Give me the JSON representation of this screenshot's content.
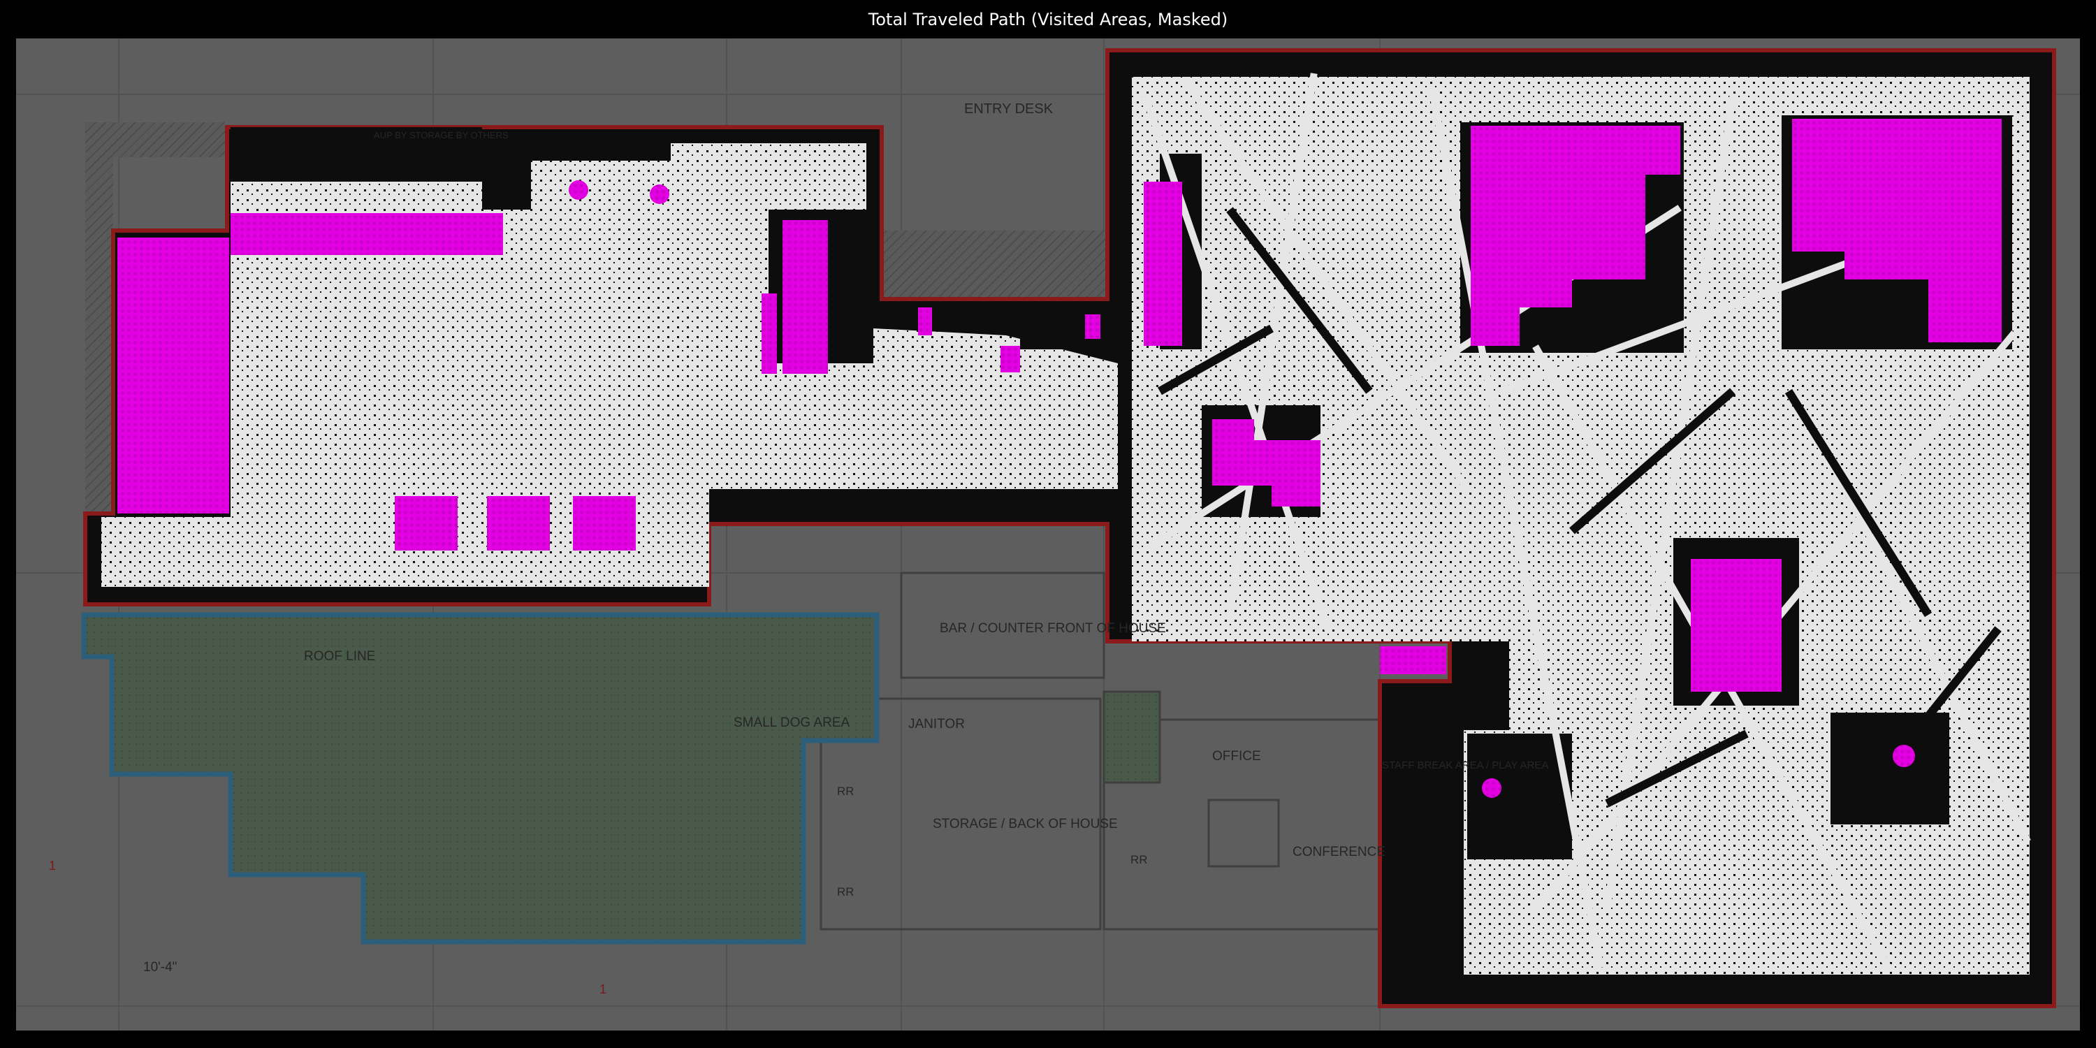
{
  "figure": {
    "title": "Total Traveled Path (Visited Areas, Masked)"
  },
  "floor_plan": {
    "labels": {
      "entry_desk": "ENTRY DESK",
      "storage_by_others": "AUP BY STORAGE BY OTHERS",
      "bar_counter": "BAR / COUNTER FRONT OF HOUSE",
      "janitor": "JANITOR",
      "small_dog_area": "SMALL DOG AREA",
      "roof_line": "ROOF LINE",
      "storage_back": "STORAGE / BACK OF HOUSE",
      "office": "OFFICE",
      "conference": "CONFERENCE",
      "staff_break": "STAFF BREAK AREA / PLAY AREA",
      "rr_upper": "RR",
      "rr_lower": "RR",
      "rr_mid": "RR",
      "dimension": "10'-4\"",
      "marker_left": "1",
      "marker_bottom": "1"
    }
  },
  "legend_colors": {
    "visited": "#e6e6e6",
    "unvisited": "#0d0d0d",
    "obstacle": "#e300e3",
    "wall_outline": "#8b1a1a",
    "outdoor_outline": "#2c5f7c",
    "background": "#5e5e5e"
  }
}
